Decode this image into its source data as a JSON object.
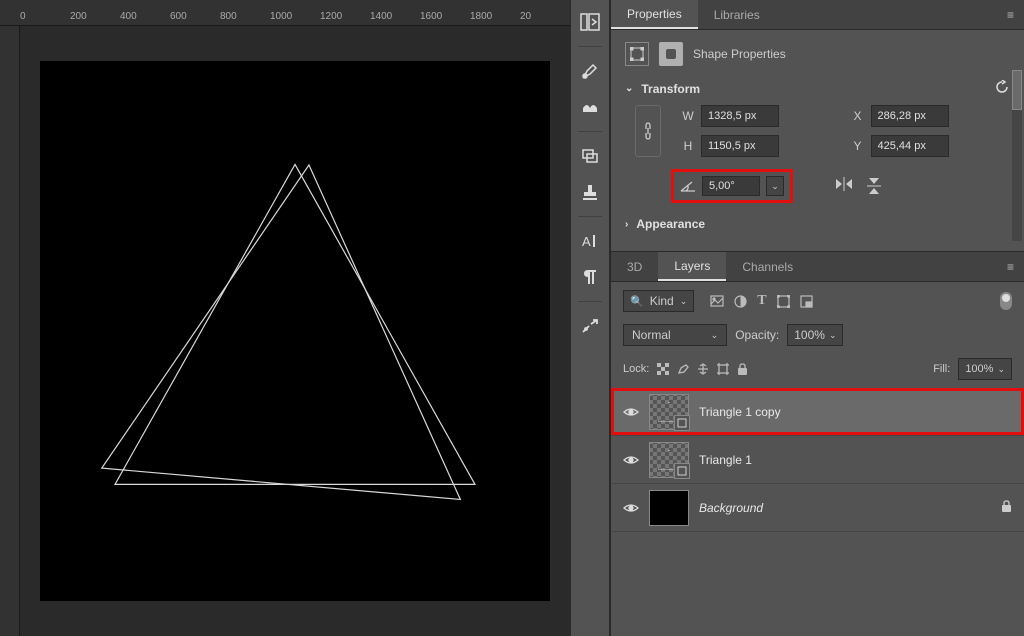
{
  "ruler": [
    "0",
    "200",
    "400",
    "600",
    "800",
    "1000",
    "1200",
    "1400",
    "1600",
    "1800",
    "20"
  ],
  "properties": {
    "tabs": {
      "properties": "Properties",
      "libraries": "Libraries"
    },
    "shape_label": "Shape Properties",
    "transform": {
      "title": "Transform",
      "w_label": "W",
      "w": "1328,5 px",
      "h_label": "H",
      "h": "1150,5 px",
      "x_label": "X",
      "x": "286,28 px",
      "y_label": "Y",
      "y": "425,44 px",
      "rotation": "5,00°"
    },
    "appearance_title": "Appearance"
  },
  "layers_panel": {
    "tabs": {
      "d3": "3D",
      "layers": "Layers",
      "channels": "Channels"
    },
    "kind_label": "Kind",
    "blend_mode": "Normal",
    "opacity_label": "Opacity:",
    "opacity_value": "100%",
    "lock_label": "Lock:",
    "fill_label": "Fill:",
    "fill_value": "100%",
    "layers": [
      {
        "name": "Triangle 1 copy"
      },
      {
        "name": "Triangle 1"
      },
      {
        "name": "Background"
      }
    ]
  }
}
